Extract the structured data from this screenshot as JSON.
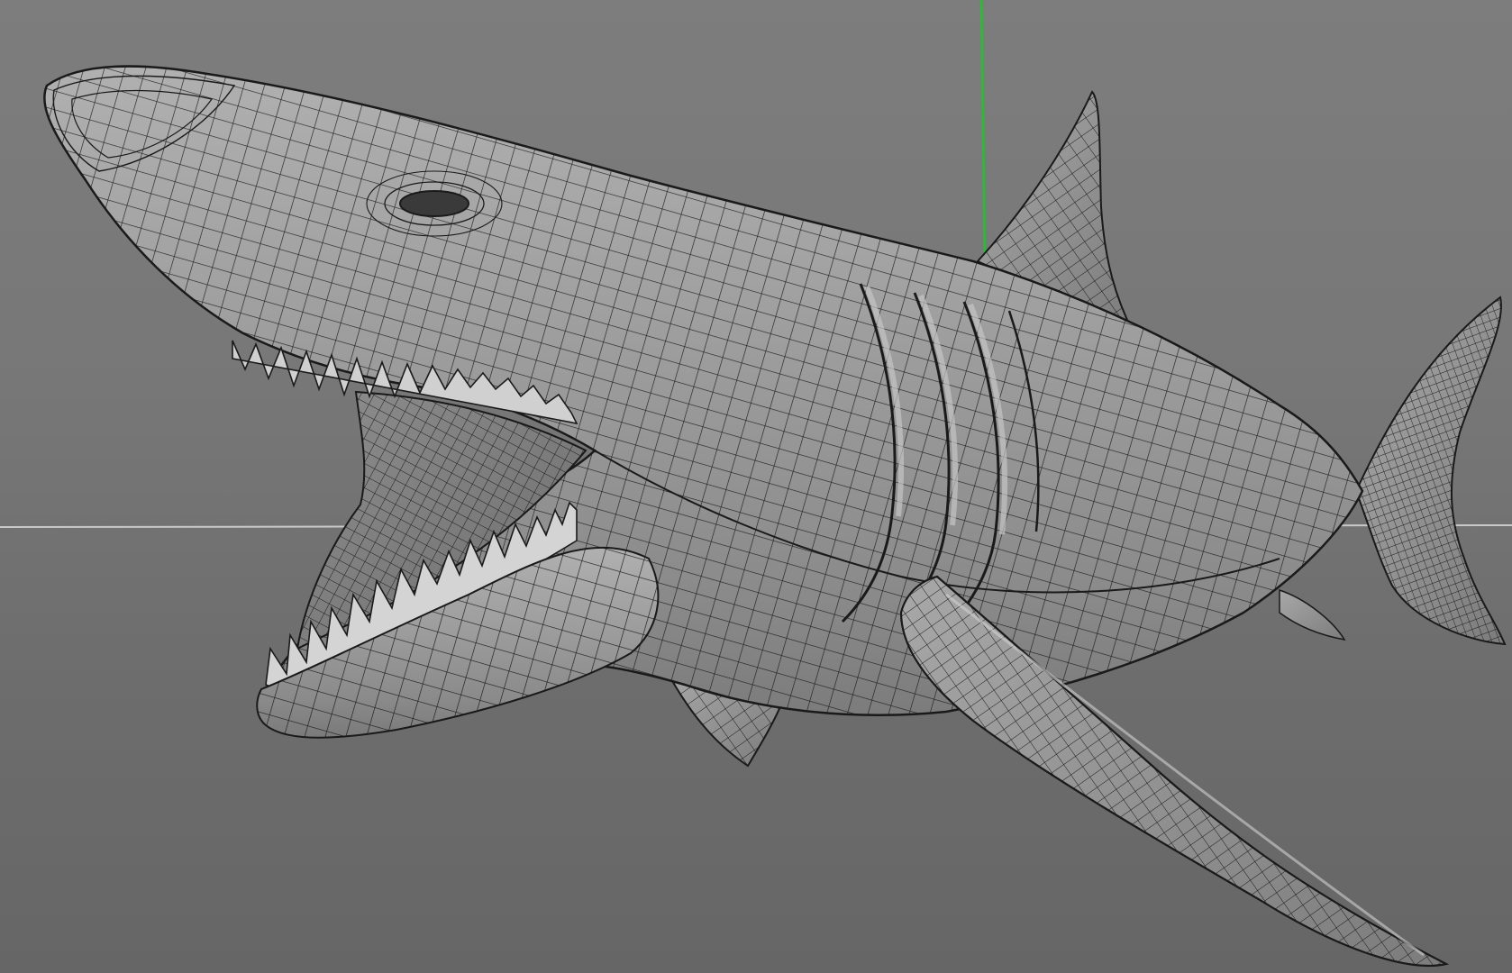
{
  "viewport": {
    "background_top": "#7d7d7d",
    "background_bottom": "#666666",
    "horizon_line_color": "#c9c9c9",
    "y_axis_color": "#1fc42a",
    "mesh_fill": "#9a9a9a",
    "mesh_wire_color": "#1a1a1a",
    "mesh_shade_dark": "#5e5e5e",
    "mesh_shade_light": "#b4b4b4",
    "object_icon": "wireframe-shark-mesh"
  }
}
